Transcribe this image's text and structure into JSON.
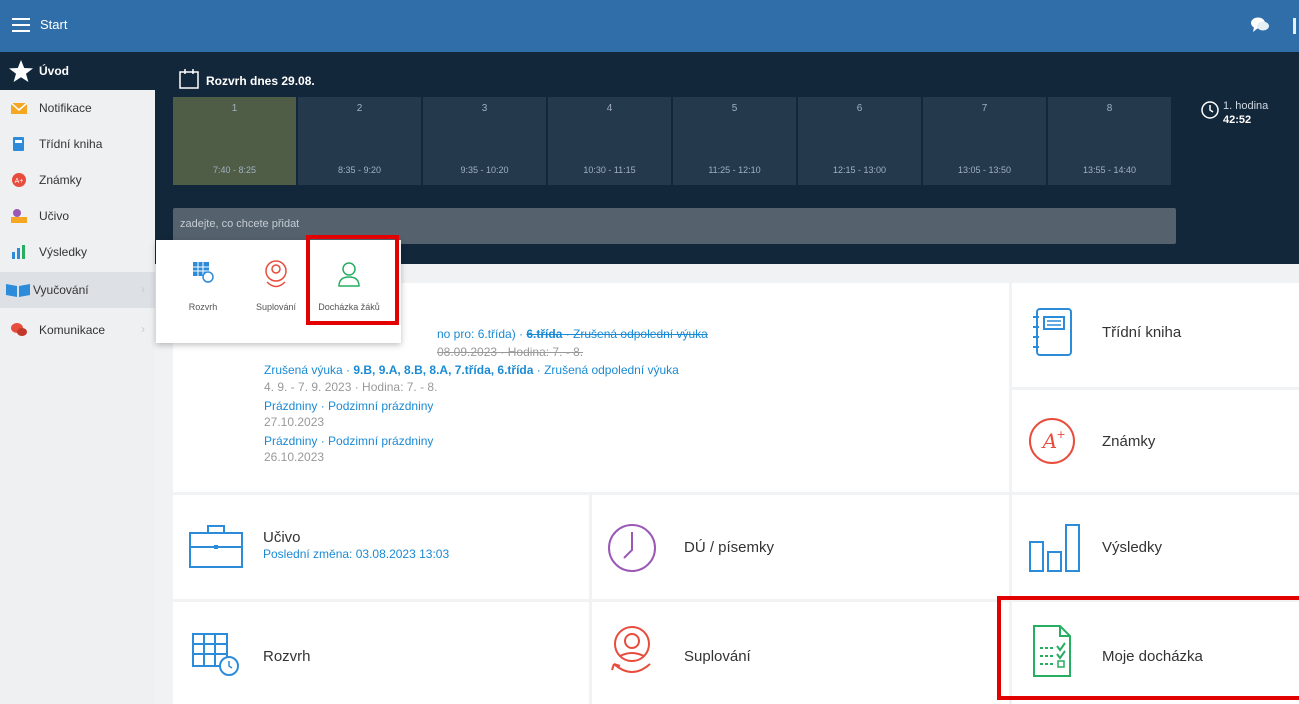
{
  "topbar": {
    "title": "Start"
  },
  "sidebar": {
    "uvod": "Úvod",
    "items": [
      {
        "label": "Notifikace",
        "icon": "envelope-icon"
      },
      {
        "label": "Třídní kniha",
        "icon": "book-icon"
      },
      {
        "label": "Známky",
        "icon": "grade-icon"
      },
      {
        "label": "Učivo",
        "icon": "student-icon"
      },
      {
        "label": "Výsledky",
        "icon": "bar-chart-icon"
      },
      {
        "label": "Vyučování",
        "icon": "open-book-icon"
      },
      {
        "label": "Komunikace",
        "icon": "chat-icon"
      }
    ]
  },
  "timetable": {
    "title": "Rozvrh dnes 29.08.",
    "periods": [
      {
        "num": "1",
        "time": "7:40 - 8:25"
      },
      {
        "num": "2",
        "time": "8:35 - 9:20"
      },
      {
        "num": "3",
        "time": "9:35 - 10:20"
      },
      {
        "num": "4",
        "time": "10:30 - 11:15"
      },
      {
        "num": "5",
        "time": "11:25 - 12:10"
      },
      {
        "num": "6",
        "time": "12:15 - 13:00"
      },
      {
        "num": "7",
        "time": "13:05 - 13:50"
      },
      {
        "num": "8",
        "time": "13:55 - 14:40"
      }
    ],
    "current_hour": "1. hodina",
    "countdown": "42:52",
    "add_placeholder": "zadejte, co chcete přidat"
  },
  "popup": {
    "items": [
      {
        "label": "Rozvrh"
      },
      {
        "label": "Suplování"
      },
      {
        "label": "Docházka žáků"
      }
    ]
  },
  "news": {
    "row1_a": "no pro: 6.třída) · ",
    "row1_b": "6.třída",
    "row1_c": " · Zrušená odpolední výuka",
    "row1_date": "08.09.2023 · Hodina: 7. - 8.",
    "row2_a": "Zrušená výuka · ",
    "row2_b": "9.B, 9.A, 8.B, 8.A, 7.třída, 6.třída",
    "row2_c": " · Zrušená odpolední výuka",
    "row2_date": "4. 9. - 7. 9. 2023 · Hodina: 7. - 8.",
    "row3": "Prázdniny · Podzimní prázdniny",
    "row3_date": "27.10.2023",
    "row4": "Prázdniny · Podzimní prázdniny",
    "row4_date": "26.10.2023"
  },
  "tiles": {
    "tridni_kniha": "Třídní kniha",
    "znamky": "Známky",
    "ucivo": "Učivo",
    "ucivo_sub": "Poslední změna: 03.08.2023 13:03",
    "du": "DÚ / písemky",
    "vysledky": "Výsledky",
    "rozvrh": "Rozvrh",
    "suplovani": "Suplování",
    "moje_dochazka": "Moje docházka"
  },
  "colors": {
    "topbar": "#2f6ea8",
    "dark": "#13273a",
    "highlight": "#e30000",
    "link": "#1a8ad4"
  }
}
